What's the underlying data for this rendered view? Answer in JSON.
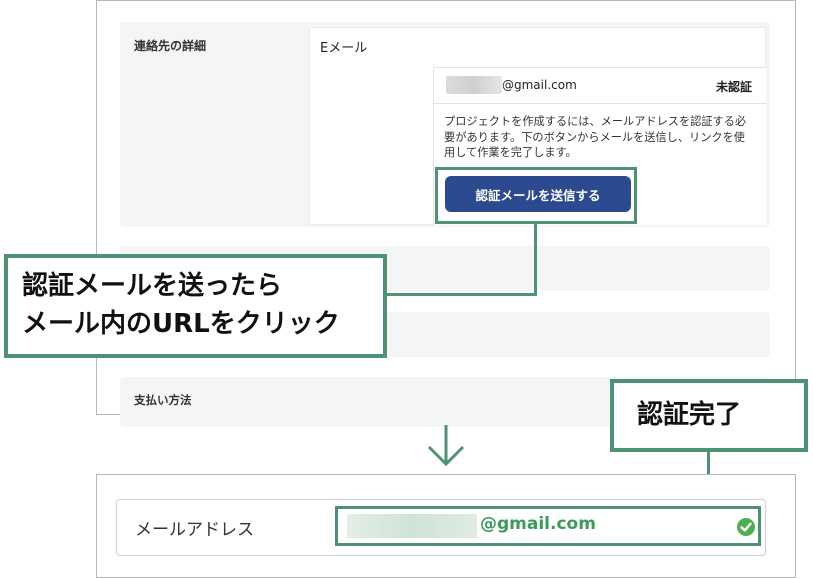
{
  "contact": {
    "section_label": "連絡先の詳細",
    "email_heading": "Eメール",
    "email_suffix": "@gmail.com",
    "status": "未認証",
    "instruction": "プロジェクトを作成するには、メールアドレスを認証する必要があります。下のボタンからメールを送信し、リンクを使用して作業を完了します。",
    "send_button": "認証メールを送信する"
  },
  "payment": {
    "section_label": "支払い方法"
  },
  "callouts": {
    "send_line1": "認証メールを送ったら",
    "send_line2": "メール内のURLをクリック",
    "done": "認証完了"
  },
  "verified": {
    "label": "メールアドレス",
    "email_suffix": "@gmail.com"
  },
  "icons": {
    "arrow": "arrow-down-icon",
    "check": "check-circle-icon"
  },
  "colors": {
    "accent_green": "#4d9272",
    "button_blue": "#2c4a8f",
    "verified_green": "#3d9a5b"
  }
}
